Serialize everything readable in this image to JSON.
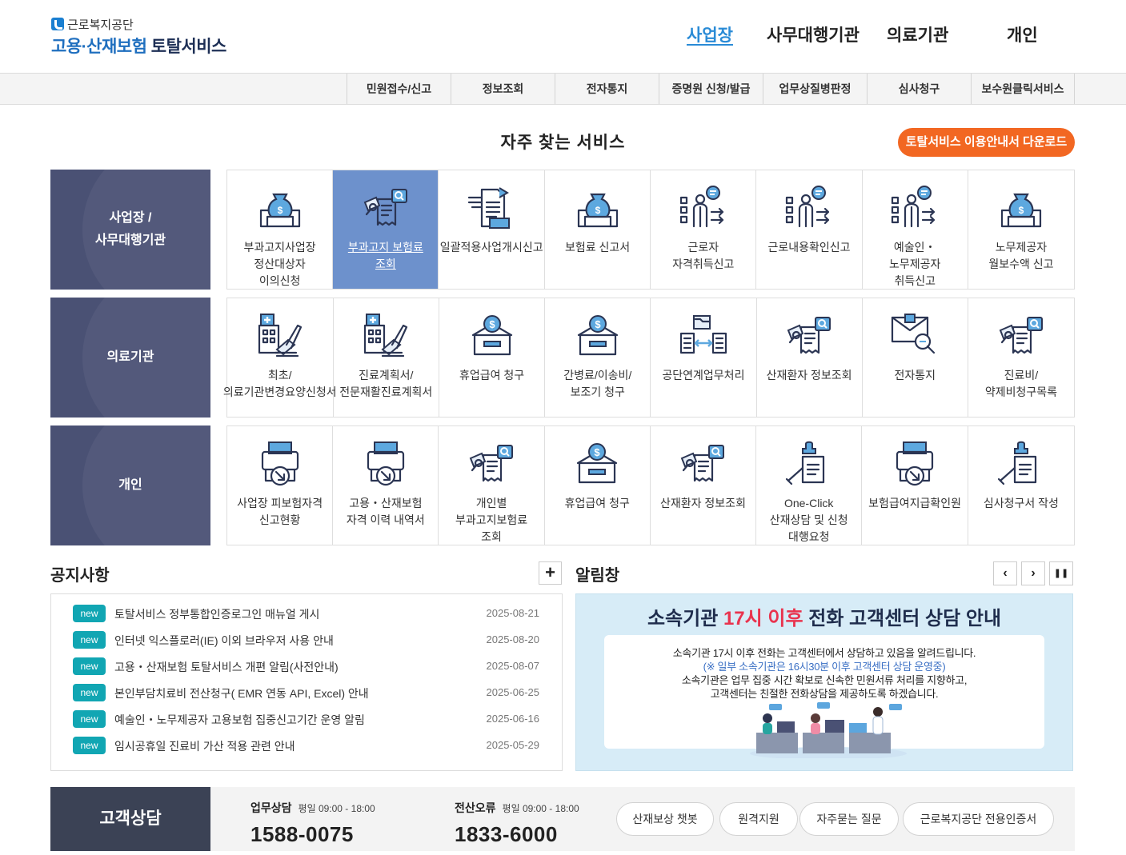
{
  "logo": {
    "top": "근로복지공단",
    "main_blue": "고용·산재보험",
    "main_dark": "토탈서비스"
  },
  "topnav": [
    "사업장",
    "사무대행기관",
    "의료기관",
    "개인"
  ],
  "subnav": [
    "민원접수/신고",
    "정보조회",
    "전자통지",
    "증명원 신청/발급",
    "업무상질병판정",
    "심사청구",
    "보수원클릭서비스"
  ],
  "services": {
    "title": "자주 찾는 서비스",
    "download_label": "토탈서비스 이용안내서 다운로드",
    "rows": [
      {
        "label": "사업장 /\n사무대행기관",
        "items": [
          {
            "label": "부과고지사업장 정산대상자 이의신청",
            "icon": "money-bag-icon"
          },
          {
            "label": "부과고지 보험료 조회",
            "icon": "document-search-icon"
          },
          {
            "label": "일괄적용사업개시신고",
            "icon": "documents-icon"
          },
          {
            "label": "보험료 신고서",
            "icon": "money-bag-icon"
          },
          {
            "label": "근로자 자격취득신고",
            "icon": "person-chat-icon"
          },
          {
            "label": "근로내용확인신고",
            "icon": "person-chat-icon"
          },
          {
            "label": "예술인・노무제공자 취득신고",
            "icon": "person-chat-icon"
          },
          {
            "label": "노무제공자 월보수액 신고",
            "icon": "money-bag-icon"
          }
        ]
      },
      {
        "label": "의료기관",
        "items": [
          {
            "label": "최초/의료기관변경요양신청서",
            "icon": "hospital-icon"
          },
          {
            "label": "진료계획서/전문재활진료계획서",
            "icon": "hospital-icon"
          },
          {
            "label": "휴업급여 청구",
            "icon": "coin-box-icon"
          },
          {
            "label": "간병료/이송비/보조기 청구",
            "icon": "coin-box-icon"
          },
          {
            "label": "공단연계업무처리",
            "icon": "exchange-icon"
          },
          {
            "label": "산재환자 정보조회",
            "icon": "document-search-icon"
          },
          {
            "label": "전자통지",
            "icon": "mail-search-icon"
          },
          {
            "label": "진료비/약제비청구목록",
            "icon": "document-search-icon"
          }
        ]
      },
      {
        "label": "개인",
        "items": [
          {
            "label": "사업장 피보험자격 신고현황",
            "icon": "printer-download-icon"
          },
          {
            "label": "고용・산재보험 자격 이력 내역서",
            "icon": "printer-download-icon"
          },
          {
            "label": "개인별 부과고지보험료 조회",
            "icon": "document-search-icon"
          },
          {
            "label": "휴업급여 청구",
            "icon": "coin-box-icon"
          },
          {
            "label": "산재환자 정보조회",
            "icon": "document-search-icon"
          },
          {
            "label": "One-Click 산재상담 및 신청 대행요청",
            "icon": "stamp-document-icon"
          },
          {
            "label": "보험급여지급확인원",
            "icon": "printer-download-icon"
          },
          {
            "label": "심사청구서 작성",
            "icon": "stamp-document-icon"
          }
        ]
      }
    ]
  },
  "notice": {
    "title": "공지사항",
    "more": "+",
    "items": [
      {
        "badge": "new",
        "text": "토탈서비스 정부통합인증로그인 매뉴얼 게시",
        "date": "2025-08-21"
      },
      {
        "badge": "new",
        "text": "인터넷 익스플로러(IE) 이외 브라우저 사용 안내",
        "date": "2025-08-20"
      },
      {
        "badge": "new",
        "text": "고용・산재보험 토탈서비스 개편 알림(사전안내)",
        "date": "2025-08-07"
      },
      {
        "badge": "new",
        "text": "본인부담치료비 전산청구( EMR 연동 API, Excel) 안내",
        "date": "2025-06-25"
      },
      {
        "badge": "new",
        "text": "예술인・노무제공자 고용보험 집중신고기간 운영 알림",
        "date": "2025-06-16"
      },
      {
        "badge": "new",
        "text": "임시공휴일 진료비 가산 적용 관련 안내",
        "date": "2025-05-29"
      }
    ]
  },
  "alert": {
    "title": "알림창",
    "controls": [
      "‹",
      "›",
      "❚❚"
    ],
    "banner_pre": "소속기관 ",
    "banner_em": "17시 이후",
    "banner_post": " 전화 고객센터 상담 안내",
    "lines": [
      "소속기관 17시 이후 전화는 고객센터에서 상담하고 있음을 알려드립니다.",
      "(※ 일부 소속기관은 16시30분 이후 고객센터 상담 운영중)",
      "소속기관은 업무 집중 시간 확보로 신속한 민원서류 처리를 지향하고,",
      "고객센터는 친절한 전화상담을 제공하도록 하겠습니다."
    ]
  },
  "footer": {
    "label": "고객상담",
    "contacts": [
      {
        "title": "업무상담",
        "hours": "평일 09:00 - 18:00",
        "phone": "1588-0075"
      },
      {
        "title": "전산오류",
        "hours": "평일 09:00 - 18:00",
        "phone": "1833-6000"
      }
    ],
    "buttons": [
      "산재보상 챗봇",
      "원격지원",
      "자주묻는 질문",
      "근로복지공단 전용인증서"
    ]
  },
  "colors": {
    "accent": "#2a8bd6",
    "row_label": "#4a5174",
    "highlight": "#6d91cc",
    "download": "#f26722",
    "badge": "#11a6b3",
    "alert_em": "#e9334e"
  }
}
